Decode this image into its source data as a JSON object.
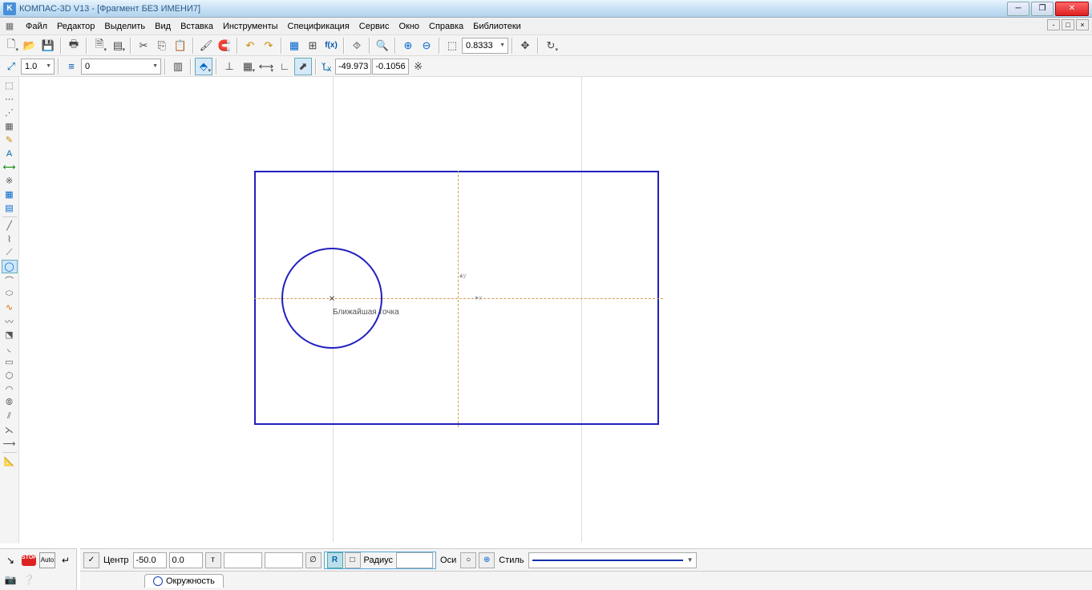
{
  "title": "КОМПАС-3D V13 - [Фрагмент БЕЗ ИМЕНИ7]",
  "menu": [
    "Файл",
    "Редактор",
    "Выделить",
    "Вид",
    "Вставка",
    "Инструменты",
    "Спецификация",
    "Сервис",
    "Окно",
    "Справка",
    "Библиотеки"
  ],
  "toolbar1": {
    "zoom_value": "0.8333"
  },
  "toolbar2": {
    "scale_value": "1.0",
    "layer_value": "0",
    "coord_x": "-49.973",
    "coord_y": "-0.1056"
  },
  "canvas": {
    "tooltip": "Ближайшая точка",
    "axis_y_label": "y",
    "axis_x_label": "x"
  },
  "bottom": {
    "chk_label": "Центр",
    "cx": "-50.0",
    "cy": "0.0",
    "radius_btn": "R",
    "radius_label": "Радиус",
    "radius_val": "",
    "axes_label": "Оси",
    "style_label": "Стиль",
    "tab_name": "Окружность"
  }
}
